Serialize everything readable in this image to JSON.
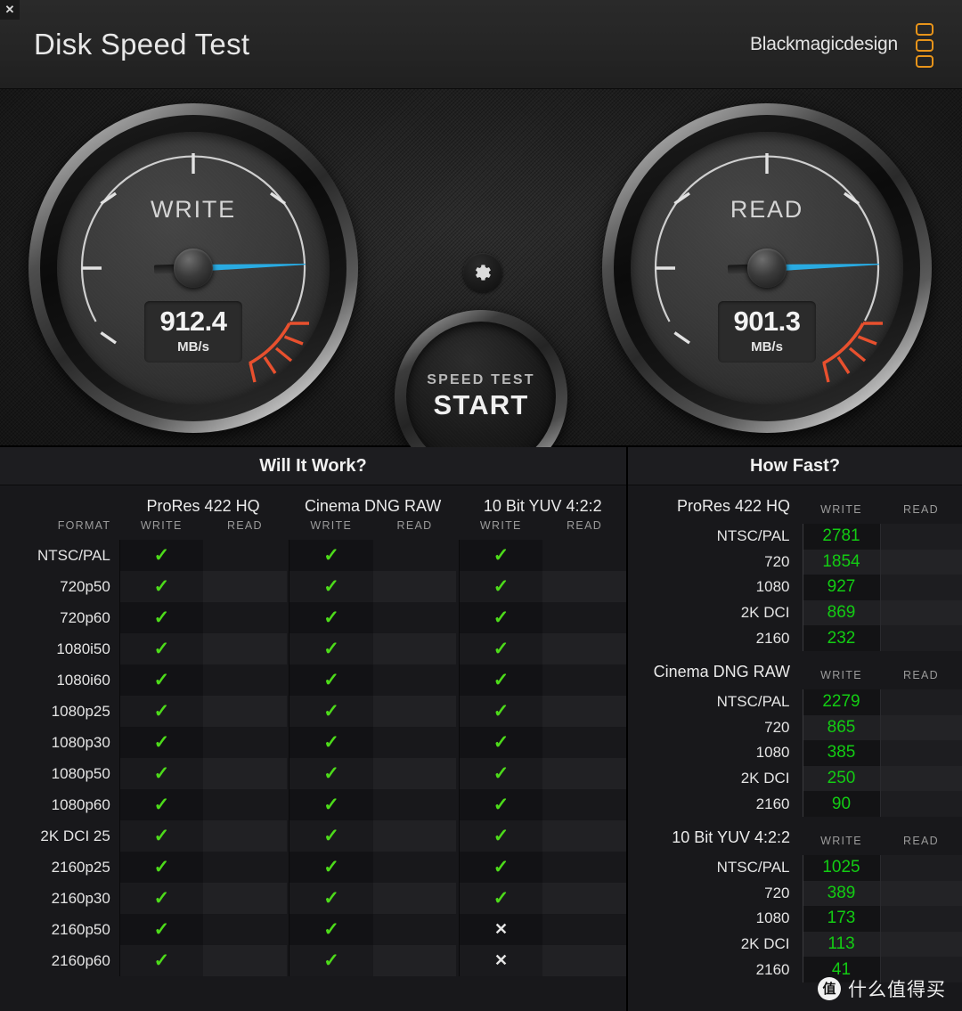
{
  "window": {
    "close_label": "✕"
  },
  "header": {
    "title": "Disk Speed Test",
    "brand": "Blackmagicdesign"
  },
  "gauges": {
    "write": {
      "label": "WRITE",
      "value": "912.4",
      "unit": "MB/s",
      "needle_deg": 178,
      "needle_color": "#29ABE2"
    },
    "read": {
      "label": "READ",
      "value": "901.3",
      "unit": "MB/s",
      "needle_deg": 178,
      "needle_color": "#29ABE2"
    }
  },
  "controls": {
    "settings_icon": "gear-icon",
    "start_line1": "SPEED TEST",
    "start_line2": "START"
  },
  "will_it_work": {
    "title": "Will It Work?",
    "format_header": "FORMAT",
    "codecs": [
      "ProRes 422 HQ",
      "Cinema DNG RAW",
      "10 Bit YUV 4:2:2"
    ],
    "sub_headers": [
      "WRITE",
      "READ"
    ],
    "marks": {
      "ok": "✓",
      "no": "✕"
    },
    "rows": [
      {
        "format": "NTSC/PAL",
        "cells": [
          "ok",
          "",
          "ok",
          "",
          "ok",
          ""
        ]
      },
      {
        "format": "720p50",
        "cells": [
          "ok",
          "",
          "ok",
          "",
          "ok",
          ""
        ]
      },
      {
        "format": "720p60",
        "cells": [
          "ok",
          "",
          "ok",
          "",
          "ok",
          ""
        ]
      },
      {
        "format": "1080i50",
        "cells": [
          "ok",
          "",
          "ok",
          "",
          "ok",
          ""
        ]
      },
      {
        "format": "1080i60",
        "cells": [
          "ok",
          "",
          "ok",
          "",
          "ok",
          ""
        ]
      },
      {
        "format": "1080p25",
        "cells": [
          "ok",
          "",
          "ok",
          "",
          "ok",
          ""
        ]
      },
      {
        "format": "1080p30",
        "cells": [
          "ok",
          "",
          "ok",
          "",
          "ok",
          ""
        ]
      },
      {
        "format": "1080p50",
        "cells": [
          "ok",
          "",
          "ok",
          "",
          "ok",
          ""
        ]
      },
      {
        "format": "1080p60",
        "cells": [
          "ok",
          "",
          "ok",
          "",
          "ok",
          ""
        ]
      },
      {
        "format": "2K DCI 25",
        "cells": [
          "ok",
          "",
          "ok",
          "",
          "ok",
          ""
        ]
      },
      {
        "format": "2160p25",
        "cells": [
          "ok",
          "",
          "ok",
          "",
          "ok",
          ""
        ]
      },
      {
        "format": "2160p30",
        "cells": [
          "ok",
          "",
          "ok",
          "",
          "ok",
          ""
        ]
      },
      {
        "format": "2160p50",
        "cells": [
          "ok",
          "",
          "ok",
          "",
          "no",
          ""
        ]
      },
      {
        "format": "2160p60",
        "cells": [
          "ok",
          "",
          "ok",
          "",
          "no",
          ""
        ]
      }
    ]
  },
  "how_fast": {
    "title": "How Fast?",
    "write_header": "WRITE",
    "read_header": "READ",
    "groups": [
      {
        "name": "ProRes 422 HQ",
        "rows": [
          {
            "label": "NTSC/PAL",
            "write": "2781",
            "read": ""
          },
          {
            "label": "720",
            "write": "1854",
            "read": ""
          },
          {
            "label": "1080",
            "write": "927",
            "read": ""
          },
          {
            "label": "2K DCI",
            "write": "869",
            "read": ""
          },
          {
            "label": "2160",
            "write": "232",
            "read": ""
          }
        ]
      },
      {
        "name": "Cinema DNG RAW",
        "rows": [
          {
            "label": "NTSC/PAL",
            "write": "2279",
            "read": ""
          },
          {
            "label": "720",
            "write": "865",
            "read": ""
          },
          {
            "label": "1080",
            "write": "385",
            "read": ""
          },
          {
            "label": "2K DCI",
            "write": "250",
            "read": ""
          },
          {
            "label": "2160",
            "write": "90",
            "read": ""
          }
        ]
      },
      {
        "name": "10 Bit YUV 4:2:2",
        "rows": [
          {
            "label": "NTSC/PAL",
            "write": "1025",
            "read": ""
          },
          {
            "label": "720",
            "write": "389",
            "read": ""
          },
          {
            "label": "1080",
            "write": "173",
            "read": ""
          },
          {
            "label": "2K DCI",
            "write": "113",
            "read": ""
          },
          {
            "label": "2160",
            "write": "41",
            "read": ""
          }
        ]
      }
    ]
  },
  "watermark": {
    "badge": "值",
    "text": "什么值得买"
  },
  "colors": {
    "needle": "#29ABE2",
    "ok_mark": "#4ddb1a",
    "speed_value": "#13cc13",
    "brand_accent": "#E8941A",
    "redzone": "#E8502E"
  }
}
